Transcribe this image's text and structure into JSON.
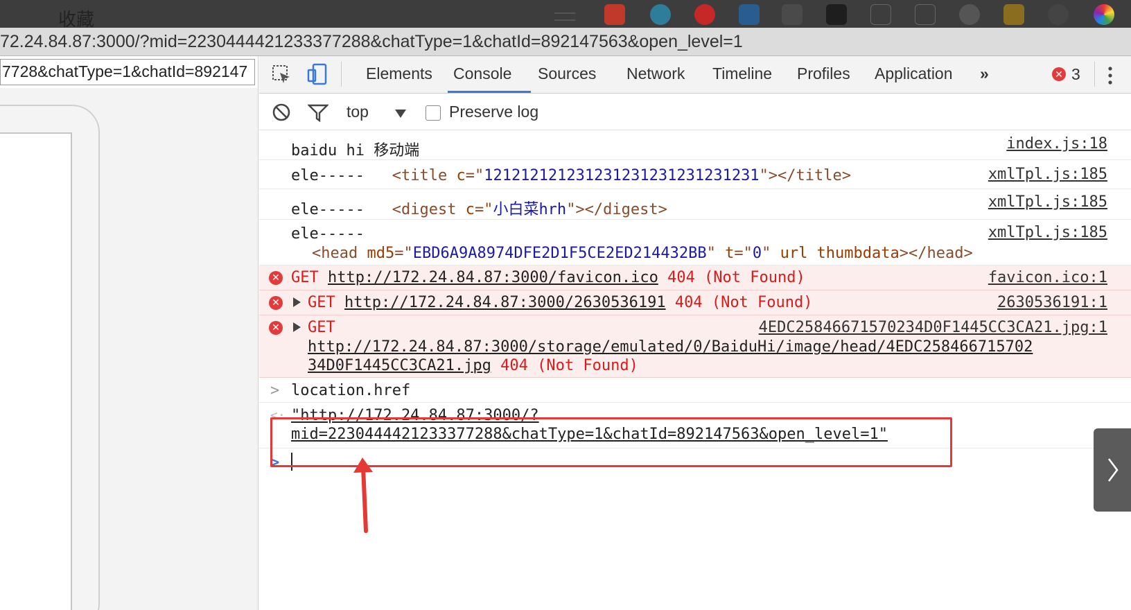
{
  "bookmarks": {
    "label": "收藏"
  },
  "address_bar": {
    "url": "72.24.84.87:3000/?mid=2230444421233377288&chatType=1&chatId=892147563&open_level=1"
  },
  "page": {
    "url_input_value": "7728&chatType=1&chatId=892147"
  },
  "devtools": {
    "tabs": [
      "Elements",
      "Console",
      "Sources",
      "Network",
      "Timeline",
      "Profiles",
      "Application"
    ],
    "active_tab": "Console",
    "more_tabs": "»",
    "error_count": "3",
    "toolbar": {
      "context": "top",
      "preserve_log": "Preserve log"
    }
  },
  "console": {
    "log1": {
      "text": "baidu hi 移动端",
      "source": "index.js:18"
    },
    "log2": {
      "prefix": "ele-----",
      "tag_open": "<title",
      "attr": "c",
      "eq": "=\"",
      "value": "121212121231231231231231231231",
      "close": "\"></title>",
      "source": "xmlTpl.js:185"
    },
    "log3": {
      "prefix": "ele-----",
      "tag_open": "<digest",
      "attr": "c",
      "eq": "=\"",
      "value": "小白菜hrh",
      "close": "\"></digest>",
      "source": "xmlTpl.js:185"
    },
    "log4": {
      "prefix": "ele-----",
      "tag_open": "<head",
      "attr1": "md5",
      "value1": "EBD6A9A8974DFE2D1F5CE2ED214432BB",
      "attr2": "t",
      "value2": "0",
      "attr3": "url thumbdata",
      "close": "></head>",
      "source": "xmlTpl.js:185"
    },
    "err1": {
      "method": "GET",
      "url": "http://172.24.84.87:3000/favicon.ico",
      "status": "404 (Not Found)",
      "source": "favicon.ico:1"
    },
    "err2": {
      "method": "GET",
      "url": "http://172.24.84.87:3000/2630536191",
      "status": "404 (Not Found)",
      "source": "2630536191:1"
    },
    "err3": {
      "method": "GET",
      "url_line1": "http://172.24.84.87:3000/storage/emulated/0/BaiduHi/image/head/4EDC258466715702",
      "url_line2": "34D0F1445CC3CA21.jpg",
      "status": "404 (Not Found)",
      "source": "4EDC25846671570234D0F1445CC3CA21.jpg:1"
    },
    "input": "location.href",
    "result_line1": "\"http://172.24.84.87:3000/?",
    "result_line2": "mid=2230444421233377288&chatType=1&chatId=892147563&open_level=1\""
  }
}
